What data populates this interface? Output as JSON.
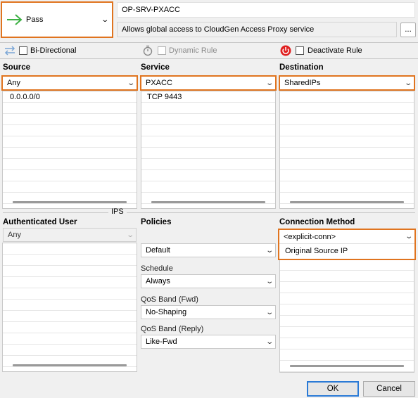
{
  "action": {
    "label": "Pass"
  },
  "rule": {
    "name": "OP-SRV-PXACC",
    "description": "Allows global access to CloudGen Access Proxy service",
    "more_label": "..."
  },
  "options": {
    "bidirectional_label": "Bi-Directional",
    "dynamic_rule_label": "Dynamic Rule",
    "deactivate_rule_label": "Deactivate Rule"
  },
  "source": {
    "header": "Source",
    "selected": "Any",
    "items": [
      "0.0.0.0/0"
    ]
  },
  "service": {
    "header": "Service",
    "selected": "PXACC",
    "items": [
      "TCP  9443"
    ]
  },
  "destination": {
    "header": "Destination",
    "selected": "SharedIPs",
    "items": []
  },
  "ips_label": "IPS",
  "authenticated_user": {
    "header": "Authenticated User",
    "selected": "Any"
  },
  "policies": {
    "header": "Policies",
    "policy_value": "Default",
    "schedule_label": "Schedule",
    "schedule_value": "Always",
    "qos_fwd_label": "QoS Band (Fwd)",
    "qos_fwd_value": "No-Shaping",
    "qos_reply_label": "QoS Band (Reply)",
    "qos_reply_value": "Like-Fwd"
  },
  "connection_method": {
    "header": "Connection Method",
    "selected": "<explicit-conn>",
    "items": [
      "Original Source IP"
    ]
  },
  "buttons": {
    "ok": "OK",
    "cancel": "Cancel"
  },
  "colors": {
    "highlight": "#e0741f",
    "pass_arrow": "#3cb043",
    "deactivate_icon": "#e02020",
    "default_button": "#2a7ad6"
  },
  "icons": [
    "pass-arrow-icon",
    "bidirectional-icon",
    "timer-icon",
    "power-icon",
    "chevron-down-icon"
  ]
}
